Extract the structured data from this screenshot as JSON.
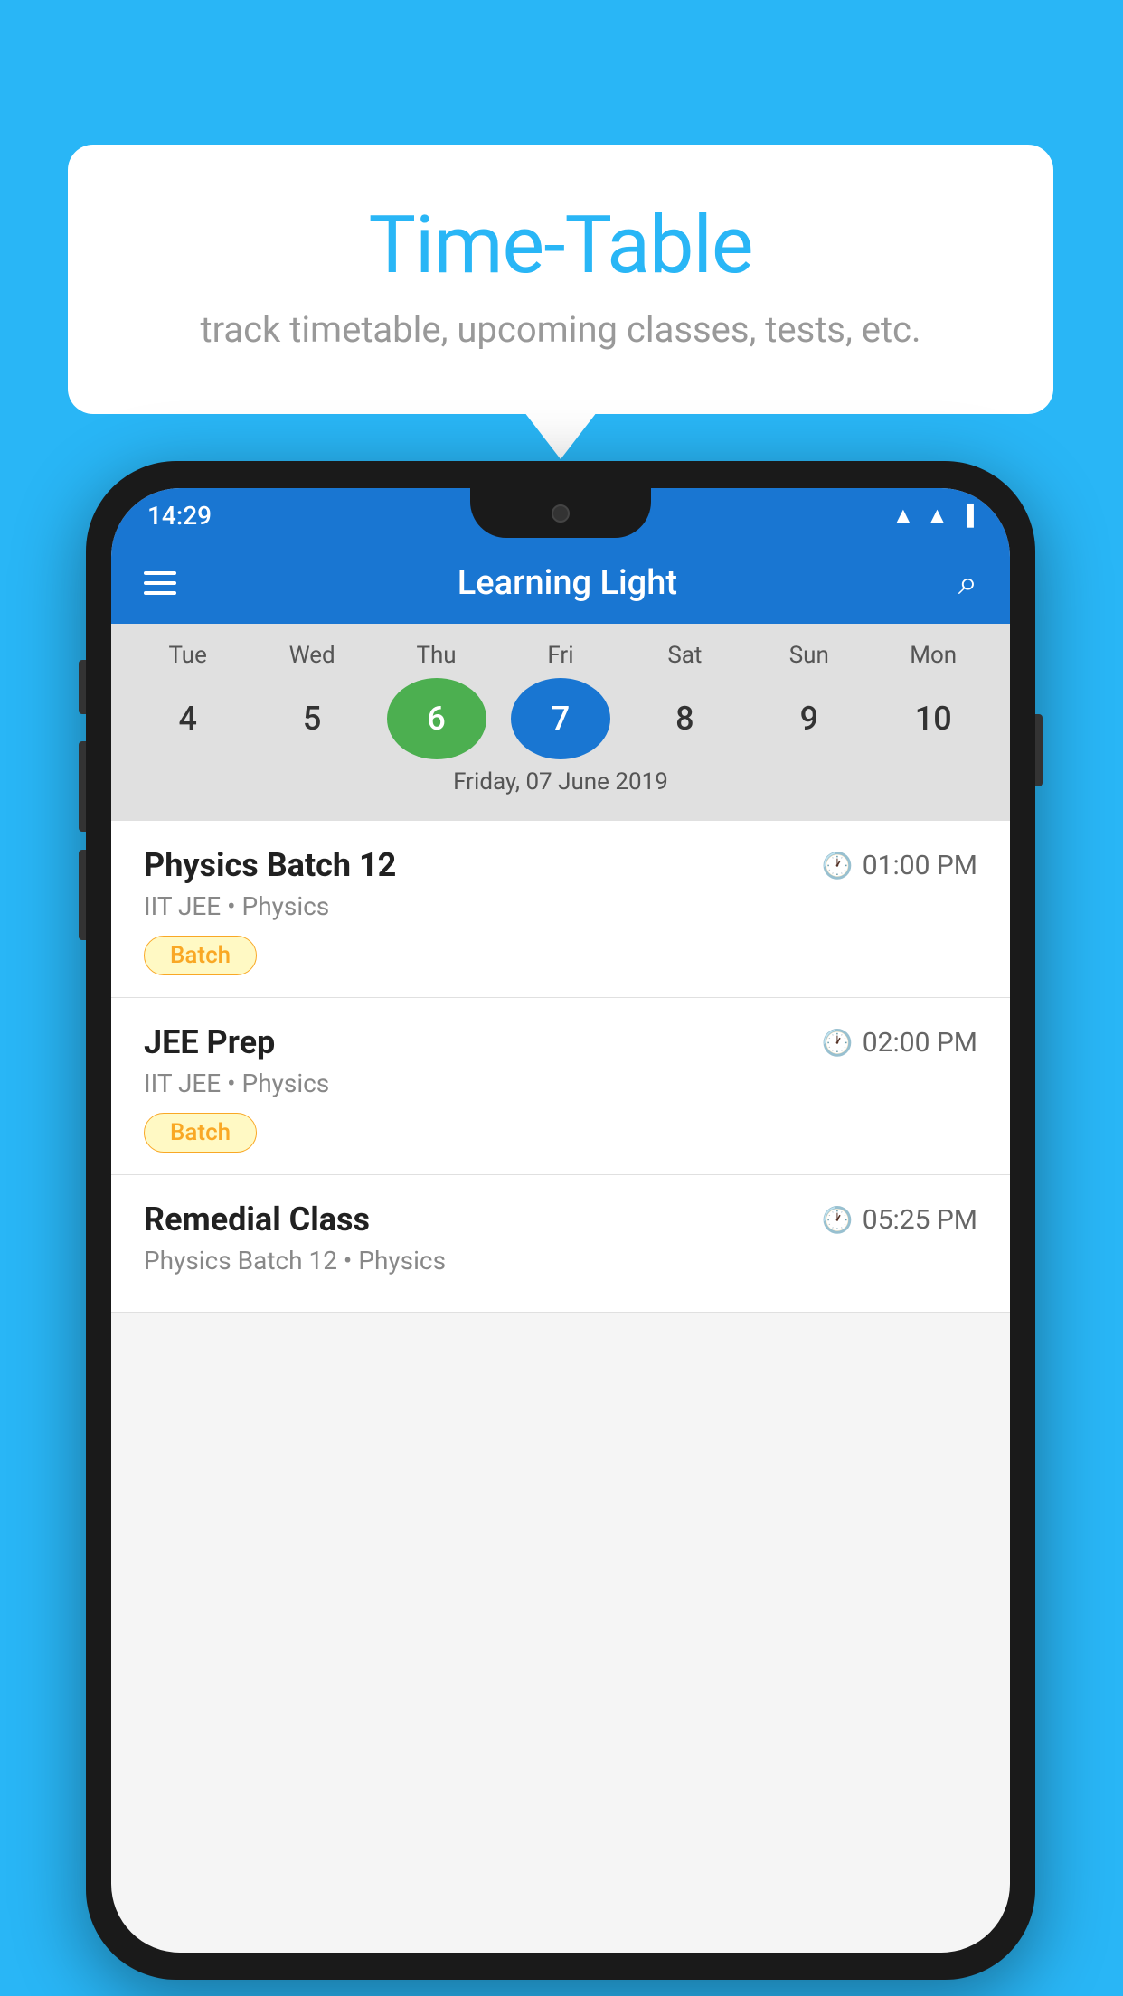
{
  "bubble": {
    "title": "Time-Table",
    "subtitle": "track timetable, upcoming classes, tests, etc."
  },
  "status_bar": {
    "time": "14:29"
  },
  "app_bar": {
    "title": "Learning Light"
  },
  "calendar": {
    "days": [
      {
        "label": "Tue",
        "num": "4"
      },
      {
        "label": "Wed",
        "num": "5"
      },
      {
        "label": "Thu",
        "num": "6",
        "state": "today"
      },
      {
        "label": "Fri",
        "num": "7",
        "state": "selected"
      },
      {
        "label": "Sat",
        "num": "8"
      },
      {
        "label": "Sun",
        "num": "9"
      },
      {
        "label": "Mon",
        "num": "10"
      }
    ],
    "selected_date": "Friday, 07 June 2019"
  },
  "schedule": [
    {
      "title": "Physics Batch 12",
      "time": "01:00 PM",
      "subtitle": "IIT JEE • Physics",
      "tag": "Batch"
    },
    {
      "title": "JEE Prep",
      "time": "02:00 PM",
      "subtitle": "IIT JEE • Physics",
      "tag": "Batch"
    },
    {
      "title": "Remedial Class",
      "time": "05:25 PM",
      "subtitle": "Physics Batch 12 • Physics",
      "tag": ""
    }
  ]
}
